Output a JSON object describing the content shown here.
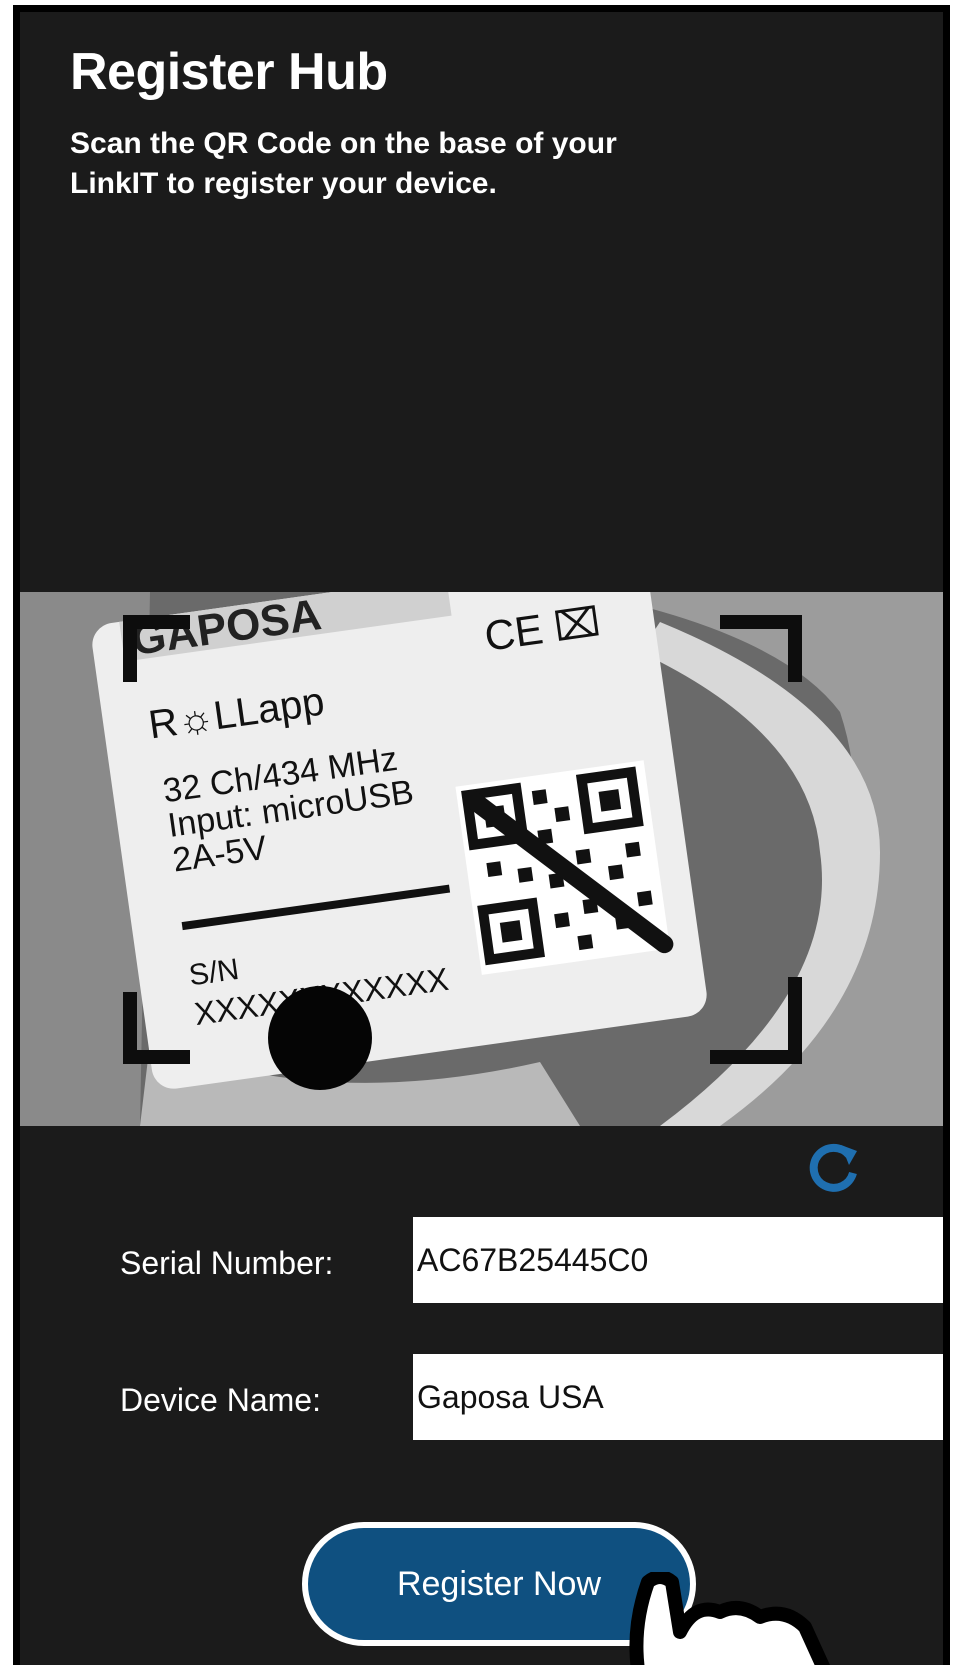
{
  "header": {
    "title": "Register Hub",
    "subtitle": "Scan the QR Code on the base of your LinkIT to register your device."
  },
  "scanner": {
    "label_lines": {
      "brand": "R☼LLapp",
      "line1": "32 Ch/434 MHz",
      "line2": "Input: microUSB",
      "line3": "2A-5V",
      "sn_label": "S/N",
      "sn_value": "XXXXXXXXXXXX",
      "ce_mark": "CE"
    }
  },
  "form": {
    "serial_label": "Serial Number:",
    "serial_value": "AC67B25445C0",
    "device_label": "Device Name:",
    "device_value": "Gaposa USA"
  },
  "actions": {
    "register_label": "Register Now"
  },
  "colors": {
    "background": "#1b1b1b",
    "accent": "#0f5080",
    "refresh_icon": "#1f6fb0"
  }
}
